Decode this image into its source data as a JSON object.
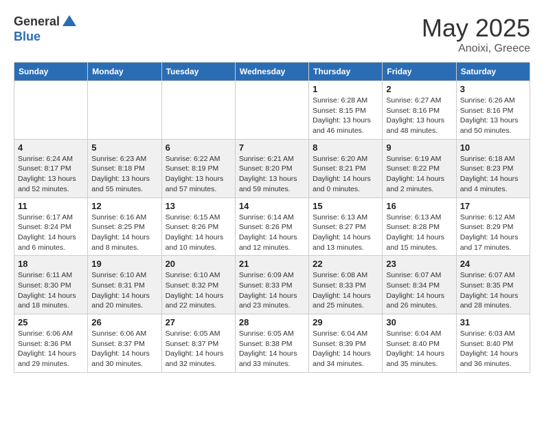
{
  "logo": {
    "general": "General",
    "blue": "Blue"
  },
  "title": "May 2025",
  "subtitle": "Anoixi, Greece",
  "weekdays": [
    "Sunday",
    "Monday",
    "Tuesday",
    "Wednesday",
    "Thursday",
    "Friday",
    "Saturday"
  ],
  "weeks": [
    [
      {
        "day": "",
        "info": ""
      },
      {
        "day": "",
        "info": ""
      },
      {
        "day": "",
        "info": ""
      },
      {
        "day": "",
        "info": ""
      },
      {
        "day": "1",
        "info": "Sunrise: 6:28 AM\nSunset: 8:15 PM\nDaylight: 13 hours\nand 46 minutes."
      },
      {
        "day": "2",
        "info": "Sunrise: 6:27 AM\nSunset: 8:16 PM\nDaylight: 13 hours\nand 48 minutes."
      },
      {
        "day": "3",
        "info": "Sunrise: 6:26 AM\nSunset: 8:16 PM\nDaylight: 13 hours\nand 50 minutes."
      }
    ],
    [
      {
        "day": "4",
        "info": "Sunrise: 6:24 AM\nSunset: 8:17 PM\nDaylight: 13 hours\nand 52 minutes."
      },
      {
        "day": "5",
        "info": "Sunrise: 6:23 AM\nSunset: 8:18 PM\nDaylight: 13 hours\nand 55 minutes."
      },
      {
        "day": "6",
        "info": "Sunrise: 6:22 AM\nSunset: 8:19 PM\nDaylight: 13 hours\nand 57 minutes."
      },
      {
        "day": "7",
        "info": "Sunrise: 6:21 AM\nSunset: 8:20 PM\nDaylight: 13 hours\nand 59 minutes."
      },
      {
        "day": "8",
        "info": "Sunrise: 6:20 AM\nSunset: 8:21 PM\nDaylight: 14 hours\nand 0 minutes."
      },
      {
        "day": "9",
        "info": "Sunrise: 6:19 AM\nSunset: 8:22 PM\nDaylight: 14 hours\nand 2 minutes."
      },
      {
        "day": "10",
        "info": "Sunrise: 6:18 AM\nSunset: 8:23 PM\nDaylight: 14 hours\nand 4 minutes."
      }
    ],
    [
      {
        "day": "11",
        "info": "Sunrise: 6:17 AM\nSunset: 8:24 PM\nDaylight: 14 hours\nand 6 minutes."
      },
      {
        "day": "12",
        "info": "Sunrise: 6:16 AM\nSunset: 8:25 PM\nDaylight: 14 hours\nand 8 minutes."
      },
      {
        "day": "13",
        "info": "Sunrise: 6:15 AM\nSunset: 8:26 PM\nDaylight: 14 hours\nand 10 minutes."
      },
      {
        "day": "14",
        "info": "Sunrise: 6:14 AM\nSunset: 8:26 PM\nDaylight: 14 hours\nand 12 minutes."
      },
      {
        "day": "15",
        "info": "Sunrise: 6:13 AM\nSunset: 8:27 PM\nDaylight: 14 hours\nand 13 minutes."
      },
      {
        "day": "16",
        "info": "Sunrise: 6:13 AM\nSunset: 8:28 PM\nDaylight: 14 hours\nand 15 minutes."
      },
      {
        "day": "17",
        "info": "Sunrise: 6:12 AM\nSunset: 8:29 PM\nDaylight: 14 hours\nand 17 minutes."
      }
    ],
    [
      {
        "day": "18",
        "info": "Sunrise: 6:11 AM\nSunset: 8:30 PM\nDaylight: 14 hours\nand 18 minutes."
      },
      {
        "day": "19",
        "info": "Sunrise: 6:10 AM\nSunset: 8:31 PM\nDaylight: 14 hours\nand 20 minutes."
      },
      {
        "day": "20",
        "info": "Sunrise: 6:10 AM\nSunset: 8:32 PM\nDaylight: 14 hours\nand 22 minutes."
      },
      {
        "day": "21",
        "info": "Sunrise: 6:09 AM\nSunset: 8:33 PM\nDaylight: 14 hours\nand 23 minutes."
      },
      {
        "day": "22",
        "info": "Sunrise: 6:08 AM\nSunset: 8:33 PM\nDaylight: 14 hours\nand 25 minutes."
      },
      {
        "day": "23",
        "info": "Sunrise: 6:07 AM\nSunset: 8:34 PM\nDaylight: 14 hours\nand 26 minutes."
      },
      {
        "day": "24",
        "info": "Sunrise: 6:07 AM\nSunset: 8:35 PM\nDaylight: 14 hours\nand 28 minutes."
      }
    ],
    [
      {
        "day": "25",
        "info": "Sunrise: 6:06 AM\nSunset: 8:36 PM\nDaylight: 14 hours\nand 29 minutes."
      },
      {
        "day": "26",
        "info": "Sunrise: 6:06 AM\nSunset: 8:37 PM\nDaylight: 14 hours\nand 30 minutes."
      },
      {
        "day": "27",
        "info": "Sunrise: 6:05 AM\nSunset: 8:37 PM\nDaylight: 14 hours\nand 32 minutes."
      },
      {
        "day": "28",
        "info": "Sunrise: 6:05 AM\nSunset: 8:38 PM\nDaylight: 14 hours\nand 33 minutes."
      },
      {
        "day": "29",
        "info": "Sunrise: 6:04 AM\nSunset: 8:39 PM\nDaylight: 14 hours\nand 34 minutes."
      },
      {
        "day": "30",
        "info": "Sunrise: 6:04 AM\nSunset: 8:40 PM\nDaylight: 14 hours\nand 35 minutes."
      },
      {
        "day": "31",
        "info": "Sunrise: 6:03 AM\nSunset: 8:40 PM\nDaylight: 14 hours\nand 36 minutes."
      }
    ]
  ]
}
